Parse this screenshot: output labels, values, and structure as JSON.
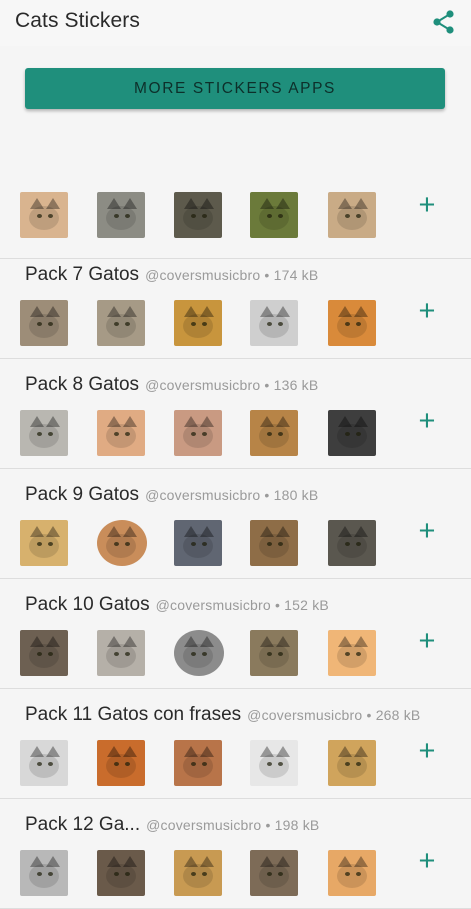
{
  "appbar": {
    "title": "Cats Stickers",
    "share_icon": "share-icon"
  },
  "more_button": {
    "label": "MORE STICKERS APPS"
  },
  "colors": {
    "accent": "#1f8f7c",
    "background": "#f5f5f5",
    "meta_text": "#9a9a9a"
  },
  "packs": [
    {
      "title": "",
      "author": "",
      "size": "",
      "add_label": "+",
      "stickers": [
        "#d9b48f",
        "#8c8c84",
        "#5d5a4c",
        "#6b7a3a",
        "#c9ab86"
      ]
    },
    {
      "title": "Pack 7 Gatos",
      "author": "@coversmusicbro",
      "size": "174 kB",
      "add_label": "+",
      "stickers": [
        "#9d8d78",
        "#a69a86",
        "#c8953d",
        "#cfcfcf",
        "#d98a3a"
      ]
    },
    {
      "title": "Pack 8 Gatos",
      "author": "@coversmusicbro",
      "size": "136 kB",
      "add_label": "+",
      "stickers": [
        "#b9b7b1",
        "#e0ab83",
        "#c99a82",
        "#b78447",
        "#3e3e3e"
      ]
    },
    {
      "title": "Pack 9 Gatos",
      "author": "@coversmusicbro",
      "size": "180 kB",
      "add_label": "+",
      "stickers": [
        "#d7b16d",
        "#c98d5a",
        "#606672",
        "#8e6d47",
        "#5a574f"
      ]
    },
    {
      "title": "Pack 10 Gatos",
      "author": "@coversmusicbro",
      "size": "152 kB",
      "add_label": "+",
      "stickers": [
        "#6d6052",
        "#b5b0a8",
        "#8c8c8c",
        "#8a7a5d",
        "#f0b677"
      ]
    },
    {
      "title": "Pack 11 Gatos con frases",
      "author": "@coversmusicbro",
      "size": "268 kB",
      "add_label": "+",
      "stickers": [
        "#d8d8d8",
        "#c96c2c",
        "#b87449",
        "#e7e7e7",
        "#d0a45c"
      ]
    },
    {
      "title": "Pack 12 Ga...",
      "author": "@coversmusicbro",
      "size": "198 kB",
      "add_label": "+",
      "stickers": [
        "#b8b8b8",
        "#6a5a4a",
        "#c89a52",
        "#7d6b57",
        "#e7a866"
      ]
    }
  ]
}
